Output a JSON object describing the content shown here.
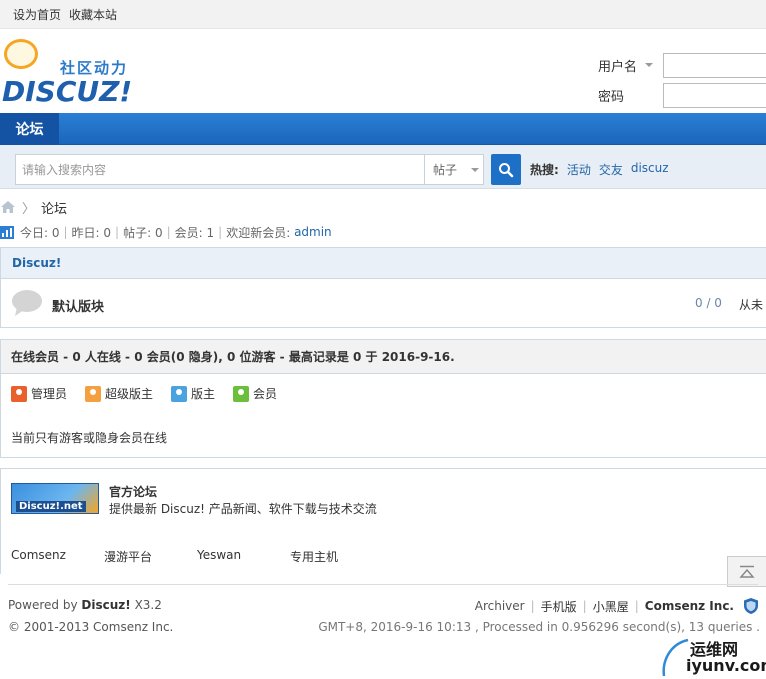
{
  "topbar": {
    "set_home": "设为首页",
    "bookmark": "收藏本站"
  },
  "header": {
    "logo_sub": "社区动力",
    "logo_main": "DISCUZ!",
    "login": {
      "username_label": "用户名",
      "password_label": "密码"
    }
  },
  "nav": {
    "tab": "论坛"
  },
  "search": {
    "placeholder": "请输入搜索内容",
    "type": "帖子",
    "hot_label": "热搜:",
    "hot_items": [
      "活动",
      "交友",
      "discuz"
    ]
  },
  "breadcrumb": {
    "current": "论坛"
  },
  "stats": {
    "today": "今日: 0",
    "yesterday": "昨日: 0",
    "posts": "帖子: 0",
    "members": "会员: 1",
    "newest_label": "欢迎新会员:",
    "newest_user": "admin"
  },
  "forum": {
    "category": "Discuz!",
    "board_name": "默认版块",
    "count": "0 / 0",
    "last": "从未"
  },
  "online": {
    "header": "在线会员 - 0 人在线 - 0 会员(0 隐身), 0 位游客 - 最高记录是 0 于 2016-9-16.",
    "legend": [
      {
        "label": "管理员",
        "color": "#e8602c"
      },
      {
        "label": "超级版主",
        "color": "#f5a040"
      },
      {
        "label": "版主",
        "color": "#4aa3df"
      },
      {
        "label": "会员",
        "color": "#6cbf3a"
      }
    ],
    "message": "当前只有游客或隐身会员在线"
  },
  "links": {
    "banner_text": "Discuz!.net",
    "official_name": "官方论坛",
    "official_desc": "提供最新 Discuz! 产品新闻、软件下载与技术交流",
    "friends": [
      "Comsenz",
      "漫游平台",
      "Yeswan",
      "专用主机"
    ]
  },
  "footer": {
    "powered_prefix": "Powered by",
    "powered_name": "Discuz!",
    "powered_version": "X3.2",
    "copyright": "© 2001-2013 Comsenz Inc.",
    "links": [
      "Archiver",
      "手机版",
      "小黑屋"
    ],
    "company": "Comsenz Inc.",
    "runtime": "GMT+8, 2016-9-16 10:13 , Processed in 0.956296 second(s), 13 queries ."
  },
  "watermark": {
    "line1": "运维网",
    "line2": "iyunv.com"
  }
}
